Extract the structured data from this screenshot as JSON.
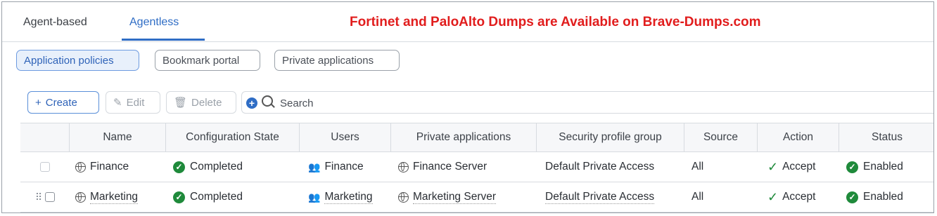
{
  "tabs": {
    "agent_based": "Agent-based",
    "agentless": "Agentless"
  },
  "banner": "Fortinet and PaloAlto Dumps are Available on Brave-Dumps.com",
  "subtabs": [
    "Application policies",
    "Bookmark portal",
    "Private applications"
  ],
  "toolbar": {
    "create": "Create",
    "edit": "Edit",
    "delete": "Delete",
    "search_placeholder": "Search"
  },
  "table": {
    "headers": [
      "Name",
      "Configuration State",
      "Users",
      "Private applications",
      "Security profile group",
      "Source",
      "Action",
      "Status"
    ],
    "rows": [
      {
        "name": "Finance",
        "state": "Completed",
        "users": "Finance",
        "private_app": "Finance Server",
        "profile": "Default Private Access",
        "source": "All",
        "action": "Accept",
        "status": "Enabled"
      },
      {
        "name": "Marketing",
        "state": "Completed",
        "users": "Marketing",
        "private_app": "Marketing Server",
        "profile": "Default Private Access",
        "source": "All",
        "action": "Accept",
        "status": "Enabled"
      }
    ]
  },
  "colors": {
    "accent": "#2f6dc5",
    "banner": "#e11d1d",
    "success": "#1f8a3b"
  }
}
